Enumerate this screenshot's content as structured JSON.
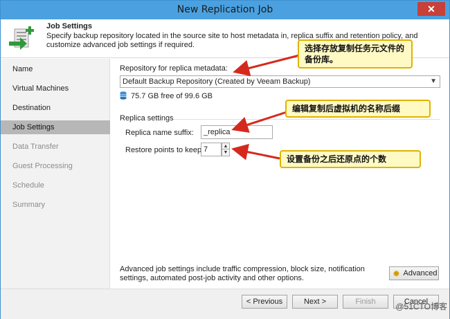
{
  "window": {
    "title": "New Replication Job",
    "close_glyph": "✕"
  },
  "header": {
    "title": "Job Settings",
    "description": "Specify backup repository located in the source site to host metadata in, replica suffix and retention policy, and customize advanced job settings if required."
  },
  "sidebar": {
    "items": [
      {
        "label": "Name",
        "state": "done"
      },
      {
        "label": "Virtual Machines",
        "state": "done"
      },
      {
        "label": "Destination",
        "state": "done"
      },
      {
        "label": "Job Settings",
        "state": "active"
      },
      {
        "label": "Data Transfer",
        "state": "future"
      },
      {
        "label": "Guest Processing",
        "state": "future"
      },
      {
        "label": "Schedule",
        "state": "future"
      },
      {
        "label": "Summary",
        "state": "future"
      }
    ]
  },
  "repository": {
    "label": "Repository for replica metadata:",
    "selected": "Default Backup Repository (Created by Veeam Backup)",
    "free_space": "75.7 GB free of 99.6 GB",
    "icon": "database-icon"
  },
  "replica_settings": {
    "section_title": "Replica settings",
    "suffix_label": "Replica name suffix:",
    "suffix_value": "_replica",
    "restore_label": "Restore points to keep:",
    "restore_value": "7"
  },
  "advanced": {
    "text": "Advanced job settings include traffic compression, block size, notification settings, automated post-job activity and other options.",
    "button_label": "Advanced",
    "icon": "gear-icon"
  },
  "footer": {
    "previous_label": "< Previous",
    "next_label": "Next >",
    "finish_label": "Finish",
    "cancel_label": "Cancel"
  },
  "callouts": {
    "repo": "选择存放复制任务元文件的备份库。",
    "suffix": "编辑复制后虚拟机的名称后缀",
    "restore": "设置备份之后还原点的个数"
  },
  "watermark": "@51CTO博客",
  "colors": {
    "titlebar": "#4ba1e0",
    "close": "#c7403a",
    "callout_fill": "#fff9c4",
    "arrow": "#d42a1e"
  }
}
